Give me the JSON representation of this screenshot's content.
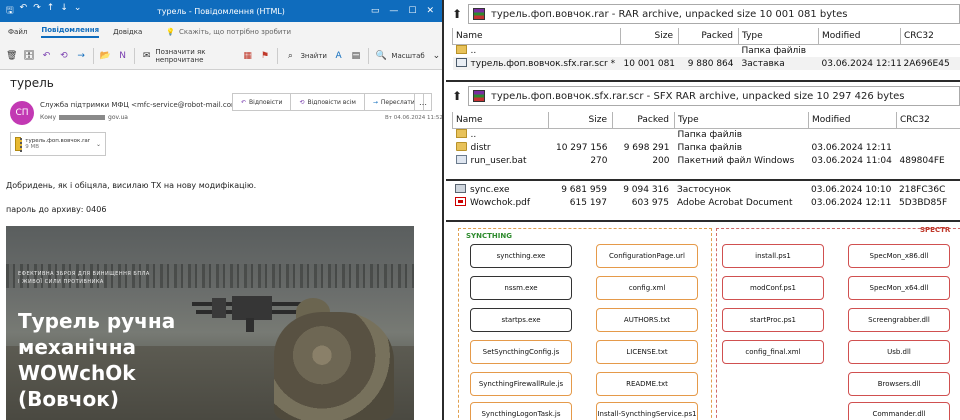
{
  "outlook": {
    "window_title": "турель - Повідомлення (HTML)",
    "menu": [
      "Файл",
      "Повідомлення",
      "Довідка"
    ],
    "menu_active": "Повідомлення",
    "tell_me": "Скажіть, що потрібно зробити",
    "ribbon": {
      "mark_unread": "Позначити як непрочитане",
      "find": "Знайти",
      "zoom": "Масштаб"
    },
    "subject": "турель",
    "avatar_initials": "СП",
    "from": "Служба підтримки МФЦ <mfc-service@robot-mail.com>",
    "to_label": "Кому",
    "to_suffix": "gov.ua",
    "actions": {
      "reply": "Відповісти",
      "reply_all": "Відповісти всім",
      "forward": "Переслати"
    },
    "date": "Вт 04.06.2024 11:52",
    "attachment": {
      "name": "турель.фоп.вовчок.rar",
      "size": "9 MB"
    },
    "body_line1": "Добридень, як і обіцяла, висилаю ТХ на нову модифікацію.",
    "body_line2": "пароль до архиву: 0406",
    "image": {
      "small_title_1": "ЕФЕКТИВНА ЗБРОЯ ДЛЯ ВИНИЩЕННЯ БПЛА",
      "small_title_2": "І ЖИВОЇ СИЛИ ПРОТИВНИКА",
      "big_title_1": "Турель ручна",
      "big_title_2": "механічна",
      "big_title_3": "WOWchOk",
      "big_title_4": "(Вовчок)"
    }
  },
  "rar_outer": {
    "path": "турель.фоп.вовчок.rar - RAR archive, unpacked size 10 001 081 bytes",
    "columns": [
      "Name",
      "Size",
      "Packed",
      "Type",
      "Modified",
      "CRC32"
    ],
    "rows": [
      {
        "name": "..",
        "size": "",
        "packed": "",
        "type": "Папка файлів",
        "modified": "",
        "crc": "",
        "icon": "up"
      },
      {
        "name": "турель.фоп.вовчок.sfx.rar.scr *",
        "size": "10 001 081",
        "packed": "9 880 864",
        "type": "Заставка",
        "modified": "03.06.2024 12:11",
        "crc": "2A696E45",
        "icon": "scr"
      }
    ]
  },
  "rar_inner": {
    "path": "турель.фоп.вовчок.sfx.rar.scr - SFX RAR archive, unpacked size 10 297 426 bytes",
    "columns": [
      "Name",
      "Size",
      "Packed",
      "Type",
      "Modified",
      "CRC32"
    ],
    "rows": [
      {
        "name": "..",
        "size": "",
        "packed": "",
        "type": "Папка файлів",
        "modified": "",
        "crc": "",
        "icon": "up"
      },
      {
        "name": "distr",
        "size": "10 297 156",
        "packed": "9 698 291",
        "type": "Папка файлів",
        "modified": "03.06.2024 12:11",
        "crc": "",
        "icon": "folder"
      },
      {
        "name": "run_user.bat",
        "size": "270",
        "packed": "200",
        "type": "Пакетний файл Windows",
        "modified": "03.06.2024 11:04",
        "crc": "489804FE",
        "icon": "bat"
      },
      {
        "name": "sync.exe",
        "size": "9 681 959",
        "packed": "9 094 316",
        "type": "Застосунок",
        "modified": "03.06.2024 10:10",
        "crc": "218FC36C",
        "icon": "exe"
      },
      {
        "name": "Wowchok.pdf",
        "size": "615 197",
        "packed": "603 975",
        "type": "Adobe Acrobat Document",
        "modified": "03.06.2024 12:11",
        "crc": "5D3BD85F",
        "icon": "pdf"
      }
    ]
  },
  "diagram": {
    "syncthing_label": "SYNCTHING",
    "spectr_label": "SPECTR",
    "syncthing_col1": [
      "syncthing.exe",
      "nssm.exe",
      "startps.exe",
      "SetSyncthingConfig.js",
      "SyncthingFirewallRule.js",
      "SyncthingLogonTask.js"
    ],
    "syncthing_col2": [
      "ConfigurationPage.url",
      "config.xml",
      "AUTHORS.txt",
      "LICENSE.txt",
      "README.txt",
      "Install-SyncthingService.ps1"
    ],
    "spectr_col1": [
      "install.ps1",
      "modConf.ps1",
      "startProc.ps1",
      "config_final.xml"
    ],
    "spectr_col2": [
      "SpecMon_x86.dll",
      "SpecMon_x64.dll",
      "Screengrabber.dll",
      "Usb.dll",
      "Browsers.dll",
      "Commander.dll"
    ],
    "colors": {
      "syncthing": "#2e8b2e",
      "spectr": "#c0392b",
      "orange_border": "#e59a4a",
      "red_border": "#d05050"
    }
  }
}
